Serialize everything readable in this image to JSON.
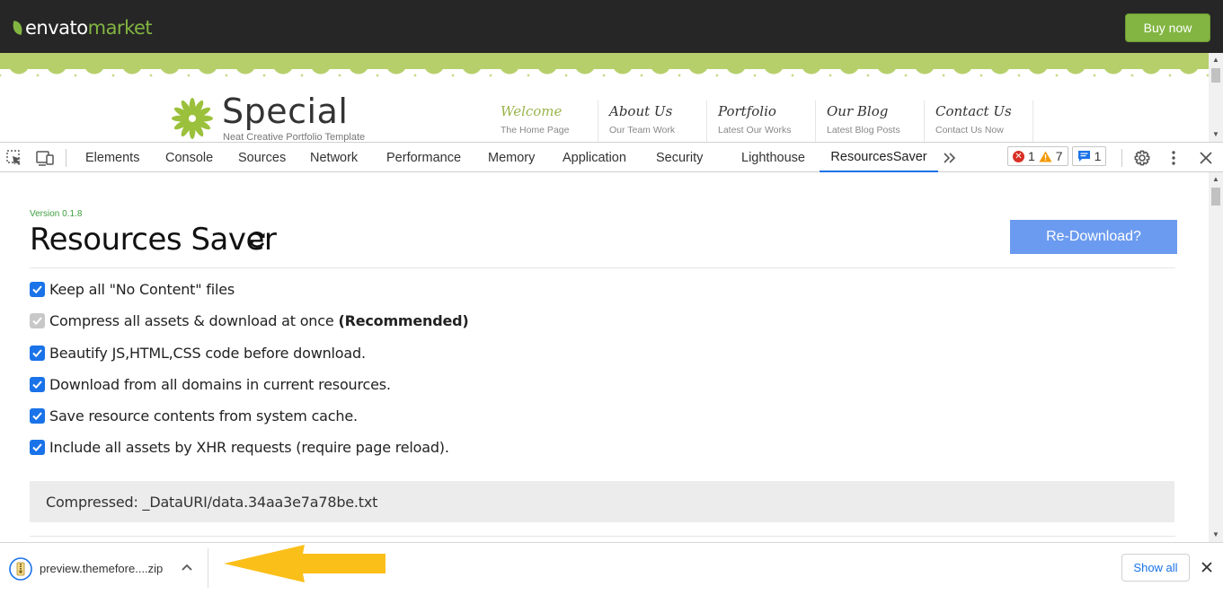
{
  "envato": {
    "logo_main": "envato",
    "logo_market": "market",
    "buy_now": "Buy now",
    "accent": "#82b541"
  },
  "site": {
    "brand": "Special",
    "tagline": "Neat Creative Portfolio Template",
    "nav": [
      {
        "title": "Welcome",
        "subtitle": "The Home Page"
      },
      {
        "title": "About Us",
        "subtitle": "Our Team Work"
      },
      {
        "title": "Portfolio",
        "subtitle": "Latest Our Works"
      },
      {
        "title": "Our Blog",
        "subtitle": "Latest Blog Posts"
      },
      {
        "title": "Contact Us",
        "subtitle": "Contact Us Now"
      }
    ]
  },
  "devtools": {
    "tabs": [
      "Elements",
      "Console",
      "Sources",
      "Network",
      "Performance",
      "Memory",
      "Application",
      "Security",
      "Lighthouse",
      "ResourcesSaver"
    ],
    "active_tab": "ResourcesSaver",
    "more_icon": "chevron-double-right-icon",
    "errors": "1",
    "warnings": "7",
    "messages": "1",
    "accent": "#1a73e8"
  },
  "saver": {
    "version": "Version 0.1.8",
    "title": "Resources Saver",
    "redownload": "Re-Download?",
    "options": [
      {
        "label": "Keep all \"No Content\" files",
        "checked": true,
        "disabled": false
      },
      {
        "label": "Compress all assets & download at once",
        "bold": "(Recommended)",
        "checked": true,
        "disabled": true
      },
      {
        "label": "Beautify JS,HTML,CSS code before download.",
        "checked": true,
        "disabled": false
      },
      {
        "label": "Download from all domains in current resources.",
        "checked": true,
        "disabled": false
      },
      {
        "label": "Save resource contents from system cache.",
        "checked": true,
        "disabled": false
      },
      {
        "label": "Include all assets by XHR requests (require page reload).",
        "checked": true,
        "disabled": false
      }
    ],
    "compressed": "Compressed: _DataURI/data.34aa3e7a78be.txt"
  },
  "downloads": {
    "file_name": "preview.themefore....zip",
    "show_all": "Show all"
  }
}
